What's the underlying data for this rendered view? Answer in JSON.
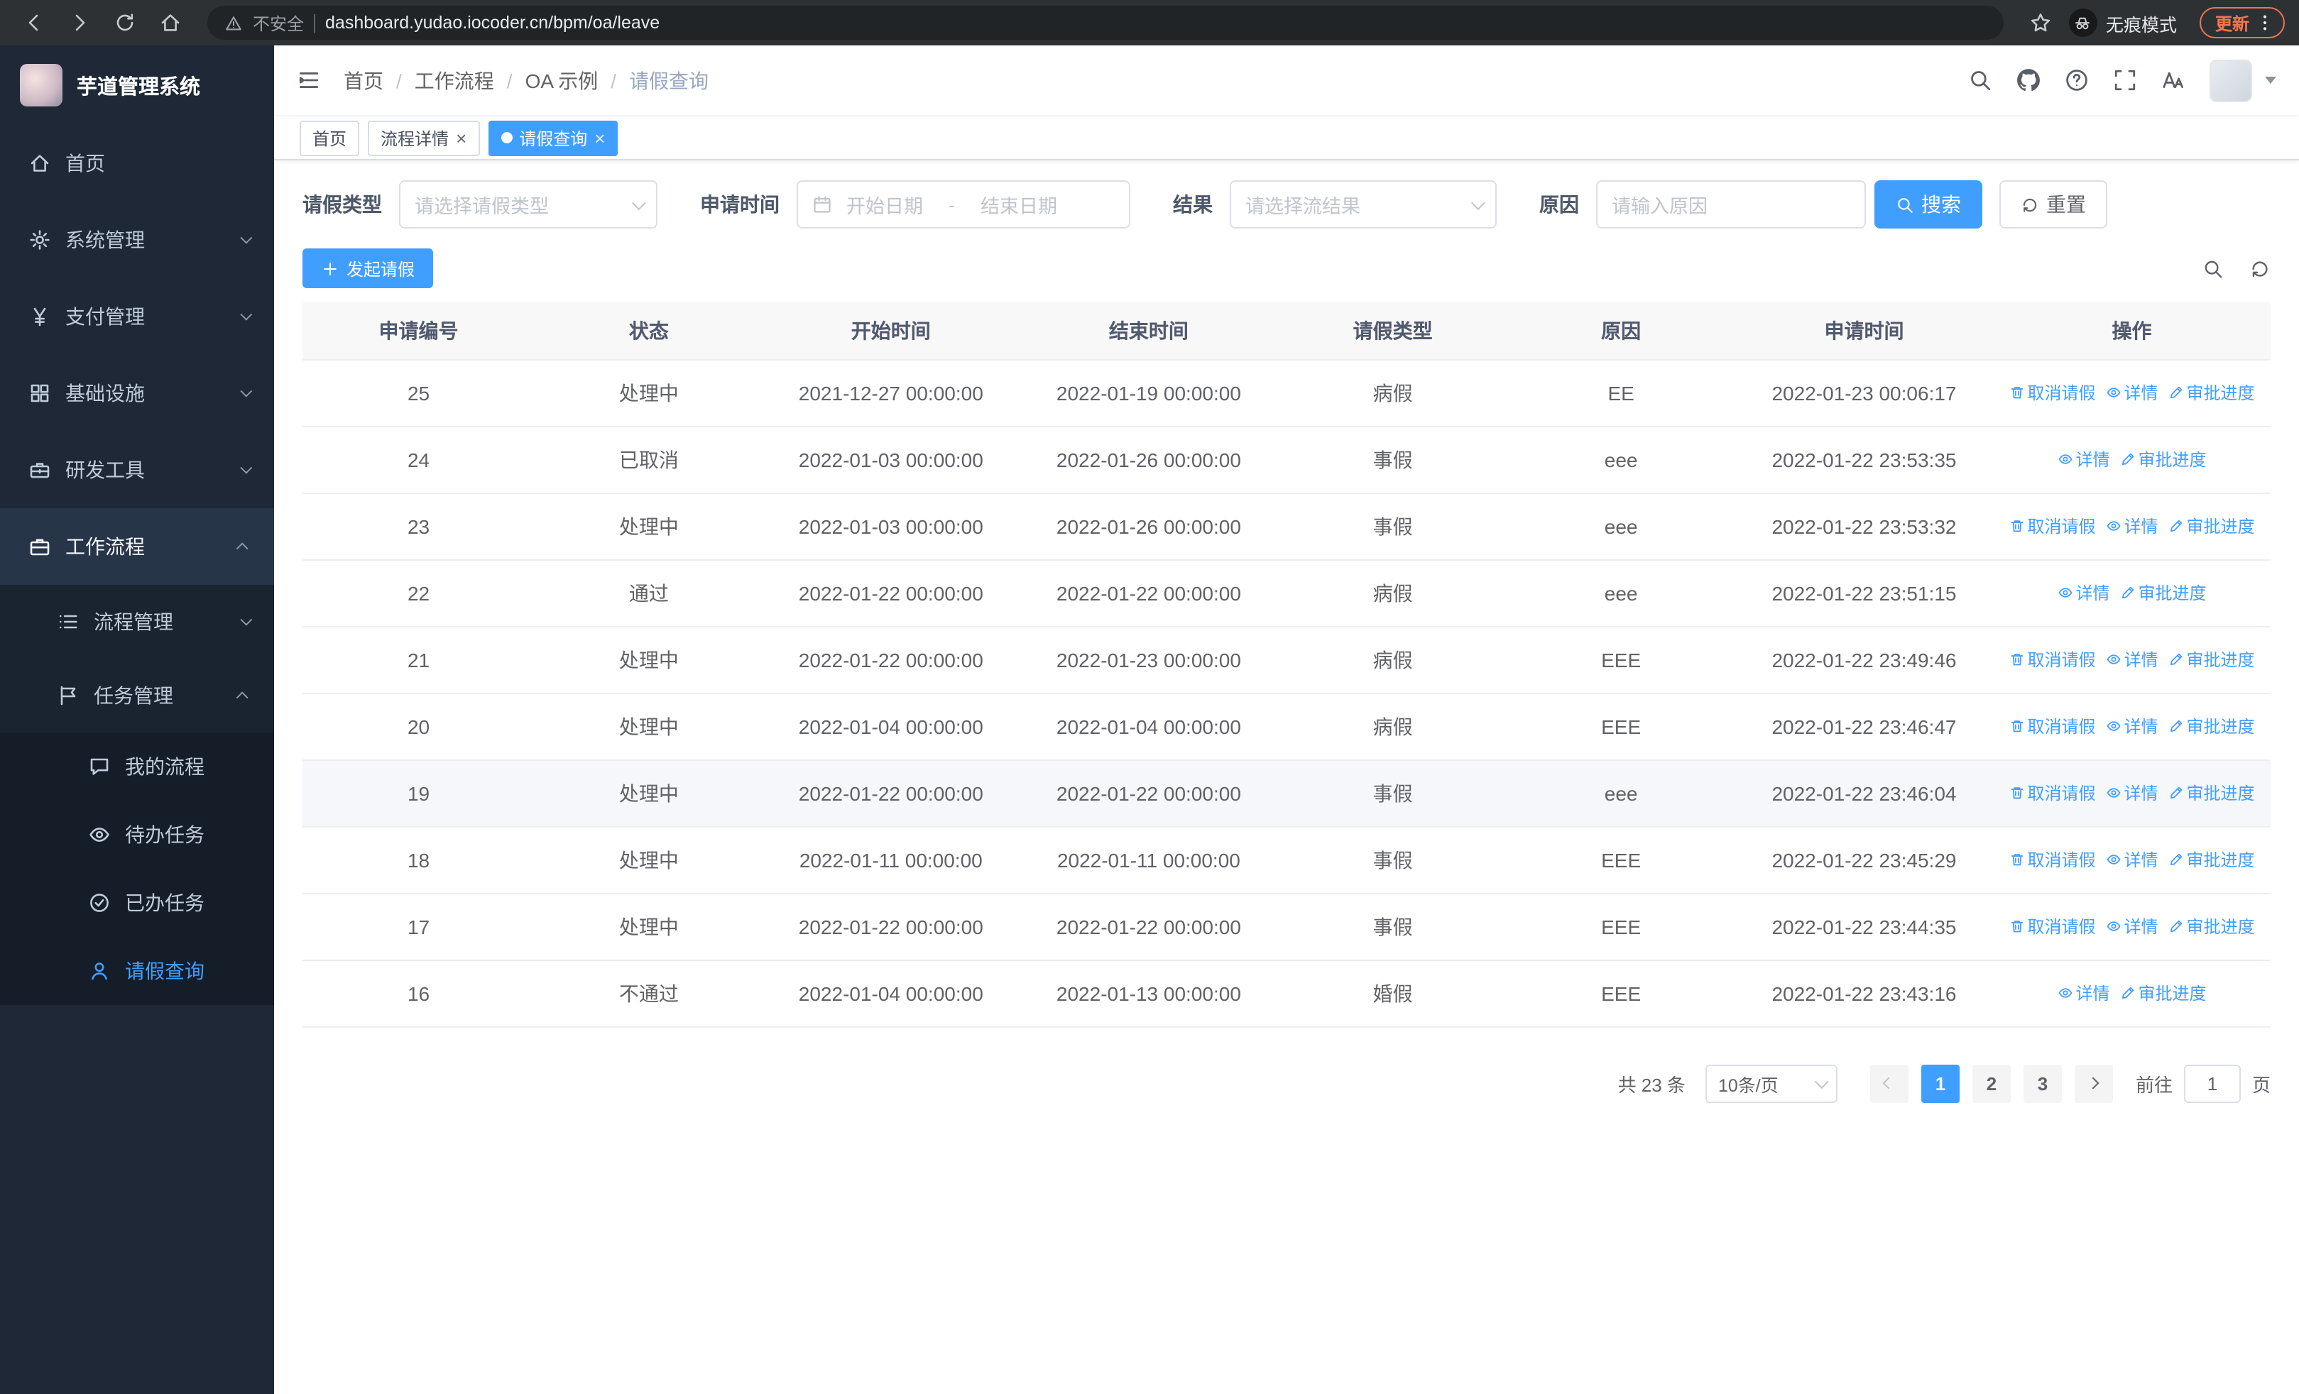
{
  "browser": {
    "security_label": "不安全",
    "url": "dashboard.yudao.iocoder.cn/bpm/oa/leave",
    "incognito_label": "无痕模式",
    "update_label": "更新"
  },
  "sidebar": {
    "app_title": "芋道管理系统",
    "items": [
      {
        "key": "home",
        "label": "首页",
        "icon": "home",
        "level": 1
      },
      {
        "key": "system",
        "label": "系统管理",
        "icon": "gear",
        "level": 1,
        "chevron": "down"
      },
      {
        "key": "payment",
        "label": "支付管理",
        "icon": "yen",
        "level": 1,
        "chevron": "down"
      },
      {
        "key": "infra",
        "label": "基础设施",
        "icon": "grid",
        "level": 1,
        "chevron": "down"
      },
      {
        "key": "devtools",
        "label": "研发工具",
        "icon": "toolbox",
        "level": 1,
        "chevron": "down"
      },
      {
        "key": "workflow",
        "label": "工作流程",
        "icon": "briefcase",
        "level": 1,
        "chevron": "up",
        "open": true
      },
      {
        "key": "process-mgmt",
        "label": "流程管理",
        "icon": "list",
        "level": 2,
        "chevron": "down"
      },
      {
        "key": "task-mgmt",
        "label": "任务管理",
        "icon": "flag",
        "level": 2,
        "chevron": "up",
        "open": true
      },
      {
        "key": "my-process",
        "label": "我的流程",
        "icon": "chat",
        "level": 3
      },
      {
        "key": "todo-task",
        "label": "待办任务",
        "icon": "eye",
        "level": 3
      },
      {
        "key": "done-task",
        "label": "已办任务",
        "icon": "check",
        "level": 3
      },
      {
        "key": "leave-query",
        "label": "请假查询",
        "icon": "user",
        "level": 3,
        "active": true
      }
    ]
  },
  "header": {
    "breadcrumb": [
      "首页",
      "工作流程",
      "OA 示例",
      "请假查询"
    ]
  },
  "tabs": [
    {
      "label": "首页",
      "closable": false,
      "active": false
    },
    {
      "label": "流程详情",
      "closable": true,
      "active": false
    },
    {
      "label": "请假查询",
      "closable": true,
      "active": true
    }
  ],
  "filters": {
    "leave_type_label": "请假类型",
    "leave_type_placeholder": "请选择请假类型",
    "apply_time_label": "申请时间",
    "start_date_placeholder": "开始日期",
    "range_separator": "-",
    "end_date_placeholder": "结束日期",
    "result_label": "结果",
    "result_placeholder": "请选择流结果",
    "reason_label": "原因",
    "reason_placeholder": "请输入原因",
    "search_label": "搜索",
    "reset_label": "重置"
  },
  "toolbar": {
    "create_label": "发起请假"
  },
  "actions": {
    "cancel": {
      "label": "取消请假",
      "icon": "trash"
    },
    "detail": {
      "label": "详情",
      "icon": "eye"
    },
    "progress": {
      "label": "审批进度",
      "icon": "edit"
    }
  },
  "table": {
    "columns": [
      "申请编号",
      "状态",
      "开始时间",
      "结束时间",
      "请假类型",
      "原因",
      "申请时间",
      "操作"
    ],
    "rows": [
      {
        "id": "25",
        "status": "处理中",
        "start": "2021-12-27 00:00:00",
        "end": "2022-01-19 00:00:00",
        "type": "病假",
        "reason": "EE",
        "applied": "2022-01-23 00:06:17",
        "actions": [
          "cancel",
          "detail",
          "progress"
        ],
        "highlight": false
      },
      {
        "id": "24",
        "status": "已取消",
        "start": "2022-01-03 00:00:00",
        "end": "2022-01-26 00:00:00",
        "type": "事假",
        "reason": "eee",
        "applied": "2022-01-22 23:53:35",
        "actions": [
          "detail",
          "progress"
        ],
        "highlight": false
      },
      {
        "id": "23",
        "status": "处理中",
        "start": "2022-01-03 00:00:00",
        "end": "2022-01-26 00:00:00",
        "type": "事假",
        "reason": "eee",
        "applied": "2022-01-22 23:53:32",
        "actions": [
          "cancel",
          "detail",
          "progress"
        ],
        "highlight": false
      },
      {
        "id": "22",
        "status": "通过",
        "start": "2022-01-22 00:00:00",
        "end": "2022-01-22 00:00:00",
        "type": "病假",
        "reason": "eee",
        "applied": "2022-01-22 23:51:15",
        "actions": [
          "detail",
          "progress"
        ],
        "highlight": false
      },
      {
        "id": "21",
        "status": "处理中",
        "start": "2022-01-22 00:00:00",
        "end": "2022-01-23 00:00:00",
        "type": "病假",
        "reason": "EEE",
        "applied": "2022-01-22 23:49:46",
        "actions": [
          "cancel",
          "detail",
          "progress"
        ],
        "highlight": false
      },
      {
        "id": "20",
        "status": "处理中",
        "start": "2022-01-04 00:00:00",
        "end": "2022-01-04 00:00:00",
        "type": "病假",
        "reason": "EEE",
        "applied": "2022-01-22 23:46:47",
        "actions": [
          "cancel",
          "detail",
          "progress"
        ],
        "highlight": false
      },
      {
        "id": "19",
        "status": "处理中",
        "start": "2022-01-22 00:00:00",
        "end": "2022-01-22 00:00:00",
        "type": "事假",
        "reason": "eee",
        "applied": "2022-01-22 23:46:04",
        "actions": [
          "cancel",
          "detail",
          "progress"
        ],
        "highlight": true
      },
      {
        "id": "18",
        "status": "处理中",
        "start": "2022-01-11 00:00:00",
        "end": "2022-01-11 00:00:00",
        "type": "事假",
        "reason": "EEE",
        "applied": "2022-01-22 23:45:29",
        "actions": [
          "cancel",
          "detail",
          "progress"
        ],
        "highlight": false
      },
      {
        "id": "17",
        "status": "处理中",
        "start": "2022-01-22 00:00:00",
        "end": "2022-01-22 00:00:00",
        "type": "事假",
        "reason": "EEE",
        "applied": "2022-01-22 23:44:35",
        "actions": [
          "cancel",
          "detail",
          "progress"
        ],
        "highlight": false
      },
      {
        "id": "16",
        "status": "不通过",
        "start": "2022-01-04 00:00:00",
        "end": "2022-01-13 00:00:00",
        "type": "婚假",
        "reason": "EEE",
        "applied": "2022-01-22 23:43:16",
        "actions": [
          "detail",
          "progress"
        ],
        "highlight": false
      }
    ]
  },
  "pagination": {
    "total": "共 23 条",
    "page_size": "10条/页",
    "pages": [
      "1",
      "2",
      "3"
    ],
    "active_page": "1",
    "goto_label": "前往",
    "goto_value": "1",
    "unit_label": "页"
  },
  "colors": {
    "accent": "#409eff",
    "sidebar_bg": "#1e2837"
  }
}
